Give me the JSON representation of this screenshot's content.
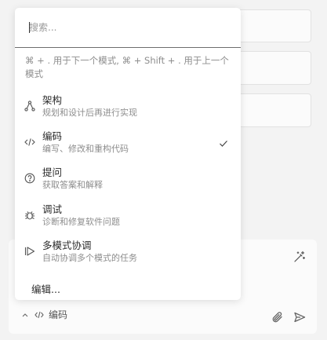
{
  "search": {
    "placeholder": "搜索..."
  },
  "hint_text": "⌘ + . 用于下一个模式, ⌘ + Shift + . 用于上一个模式",
  "modes": [
    {
      "title": "架构",
      "desc": "规划和设计后再进行实现",
      "icon": "architecture-icon",
      "selected": false
    },
    {
      "title": "编码",
      "desc": "编写、修改和重构代码",
      "icon": "code-icon",
      "selected": true
    },
    {
      "title": "提问",
      "desc": "获取答案和解释",
      "icon": "question-icon",
      "selected": false
    },
    {
      "title": "调试",
      "desc": "诊断和修复软件问题",
      "icon": "bug-icon",
      "selected": false
    },
    {
      "title": "多模式协调",
      "desc": "自动协调多个模式的任务",
      "icon": "orchestrator-icon",
      "selected": false
    }
  ],
  "edit_label": "编辑...",
  "composer": {
    "current_mode_label": "编码"
  },
  "colors": {
    "background": "#f3f3f3",
    "popup": "#ffffff",
    "muted_text": "#8d8d8d"
  }
}
